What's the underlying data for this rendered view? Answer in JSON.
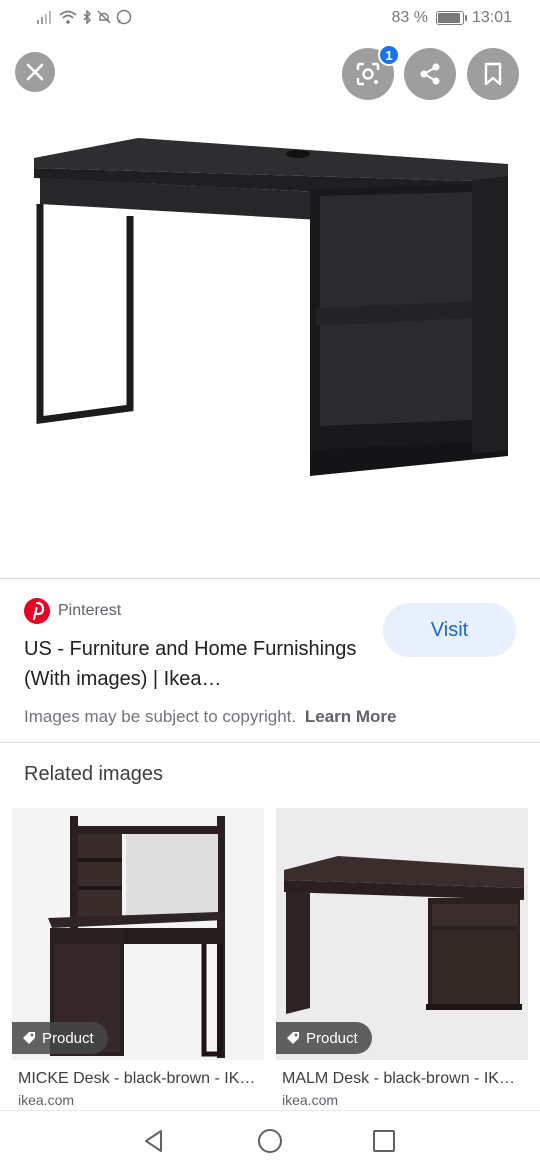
{
  "status_bar": {
    "battery_text": "83 %",
    "battery_level": 0.83,
    "time": "13:01"
  },
  "top_actions": {
    "lens_badge": "1",
    "icons": [
      "close-icon",
      "lens-icon",
      "share-icon",
      "bookmark-icon"
    ]
  },
  "result": {
    "source": "Pinterest",
    "title": "US - Furniture and Home Furnishings (With images) | Ikea…",
    "visit_label": "Visit",
    "copyright_text": "Images may be subject to copyright.",
    "learn_more": "Learn More"
  },
  "related": {
    "heading": "Related images",
    "items": [
      {
        "chip": "Product",
        "title": "MICKE Desk - black-brown - IK…",
        "domain": "ikea.com"
      },
      {
        "chip": "Product",
        "title": "MALM Desk - black-brown - IK…",
        "domain": "ikea.com"
      }
    ]
  },
  "colors": {
    "accent": "#1a73e8",
    "visit_bg": "#e8f0fe",
    "pinterest": "#e60023",
    "desk": "#2b2b2e"
  },
  "nav": {
    "icons": [
      "back-icon",
      "home-icon",
      "recents-icon"
    ]
  }
}
